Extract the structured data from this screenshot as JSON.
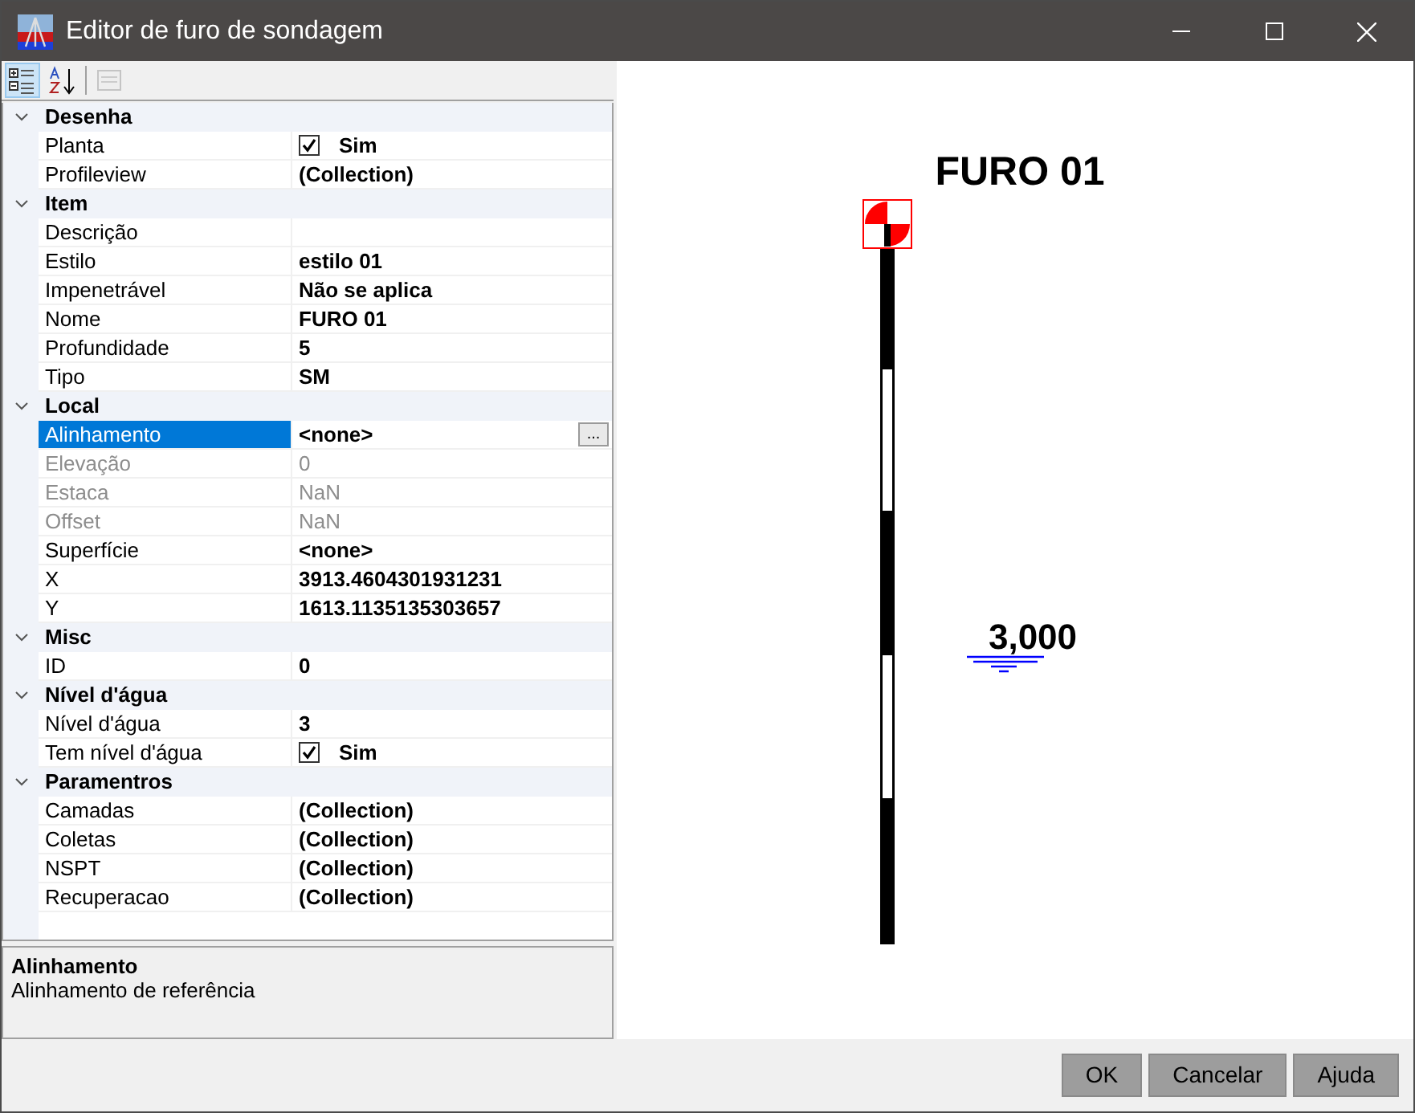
{
  "window": {
    "title": "Editor de furo de sondagem"
  },
  "toolbar": [
    {
      "kind": "categorized",
      "selected": true,
      "disabled": false
    },
    {
      "kind": "alphabetical",
      "selected": false,
      "disabled": false
    },
    {
      "kind": "pages",
      "selected": false,
      "disabled": true
    }
  ],
  "property_grid": [
    {
      "name": "Desenha",
      "expanded": true,
      "properties": [
        {
          "name": "Planta",
          "value": "Sim",
          "kind": "checkbox",
          "checked": true,
          "disabled": false,
          "selected": false
        },
        {
          "name": "Profileview",
          "value": "(Collection)",
          "kind": "text",
          "disabled": false,
          "selected": false
        }
      ]
    },
    {
      "name": "Item",
      "expanded": true,
      "properties": [
        {
          "name": "Descrição",
          "kind": "text",
          "disabled": false,
          "selected": false
        },
        {
          "name": "Estilo",
          "value": "estilo 01",
          "kind": "text",
          "disabled": false,
          "selected": false
        },
        {
          "name": "Impenetrável",
          "value": "Não se aplica",
          "kind": "text",
          "disabled": false,
          "selected": false
        },
        {
          "name": "Nome",
          "value": "FURO 01",
          "kind": "text",
          "disabled": false,
          "selected": false
        },
        {
          "name": "Profundidade",
          "value": "5",
          "kind": "text",
          "disabled": false,
          "selected": false
        },
        {
          "name": "Tipo",
          "value": "SM",
          "kind": "text",
          "disabled": false,
          "selected": false
        }
      ]
    },
    {
      "name": "Local",
      "expanded": true,
      "properties": [
        {
          "name": "Alinhamento",
          "value": "<none>",
          "kind": "text",
          "disabled": false,
          "selected": true,
          "button_label": "..."
        },
        {
          "name": "Elevação",
          "value": "0",
          "kind": "text",
          "disabled": true,
          "selected": false
        },
        {
          "name": "Estaca",
          "value": "NaN",
          "kind": "text",
          "disabled": true,
          "selected": false
        },
        {
          "name": "Offset",
          "value": "NaN",
          "kind": "text",
          "disabled": true,
          "selected": false
        },
        {
          "name": "Superfície",
          "value": "<none>",
          "kind": "text",
          "disabled": false,
          "selected": false
        },
        {
          "name": "X",
          "value": "3913.4604301931231",
          "kind": "text",
          "disabled": false,
          "selected": false
        },
        {
          "name": "Y",
          "value": "1613.1135135303657",
          "kind": "text",
          "disabled": false,
          "selected": false
        }
      ]
    },
    {
      "name": "Misc",
      "expanded": true,
      "properties": [
        {
          "name": "ID",
          "value": "0",
          "kind": "text",
          "disabled": false,
          "selected": false
        }
      ]
    },
    {
      "name": "Nível d'água",
      "expanded": true,
      "properties": [
        {
          "name": "Nível d'água",
          "value": "3",
          "kind": "text",
          "disabled": false,
          "selected": false
        },
        {
          "name": "Tem nível d'água",
          "value": "Sim",
          "kind": "checkbox",
          "checked": true,
          "disabled": false,
          "selected": false
        }
      ]
    },
    {
      "name": "Paramentros",
      "expanded": true,
      "properties": [
        {
          "name": "Camadas",
          "value": "(Collection)",
          "kind": "text",
          "disabled": false,
          "selected": false
        },
        {
          "name": "Coletas",
          "value": "(Collection)",
          "kind": "text",
          "disabled": false,
          "selected": false
        },
        {
          "name": "NSPT",
          "value": "(Collection)",
          "kind": "text",
          "disabled": false,
          "selected": false
        },
        {
          "name": "Recuperacao",
          "value": "(Collection)",
          "kind": "text",
          "disabled": false,
          "selected": false
        }
      ]
    }
  ],
  "description": {
    "title": "Alinhamento",
    "text": "Alinhamento de referência"
  },
  "drawing": {
    "title": "FURO 01",
    "water_level_label": "3,000"
  },
  "buttons": [
    "OK",
    "Cancelar",
    "Ajuda"
  ]
}
